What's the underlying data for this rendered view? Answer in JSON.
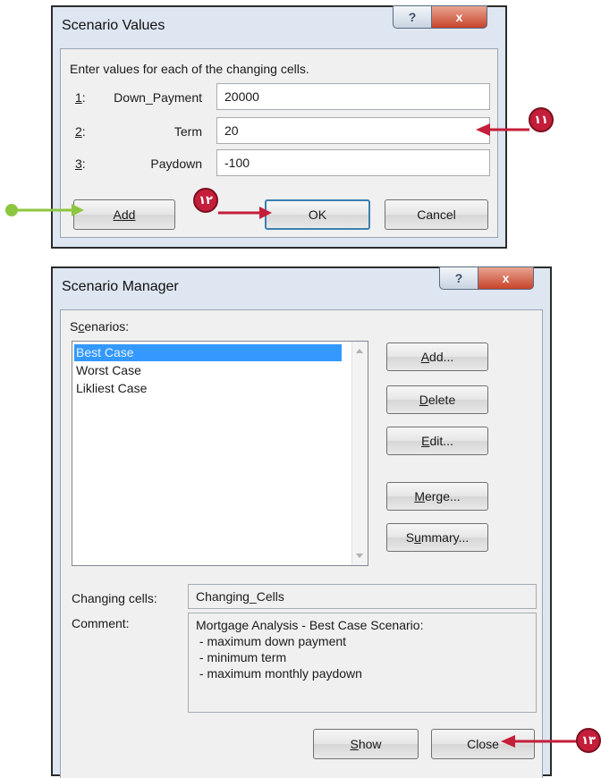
{
  "scenario_values": {
    "title": "Scenario Values",
    "help_glyph": "?",
    "close_glyph": "x",
    "instruction": "Enter values for each of the changing cells.",
    "rows": [
      {
        "index": "1",
        "index_suffix": ":",
        "label": "Down_Payment",
        "value": "20000"
      },
      {
        "index": "2",
        "index_suffix": ":",
        "label": "Term",
        "value": "20"
      },
      {
        "index": "3",
        "index_suffix": ":",
        "label": "Paydown",
        "value": "-100"
      }
    ],
    "buttons": {
      "add": "Add",
      "ok": "OK",
      "cancel": "Cancel"
    }
  },
  "scenario_manager": {
    "title": "Scenario Manager",
    "help_glyph": "?",
    "close_glyph": "x",
    "scenarios_label_pre": "S",
    "scenarios_label_u": "c",
    "scenarios_label_post": "enarios:",
    "scenarios": [
      "Best Case",
      "Worst Case",
      "Likliest Case"
    ],
    "selected_index": 0,
    "buttons": {
      "add": {
        "u": "A",
        "rest": "dd..."
      },
      "delete": {
        "u": "D",
        "rest": "elete"
      },
      "edit": {
        "u": "E",
        "rest": "dit..."
      },
      "merge": {
        "u": "M",
        "rest": "erge..."
      },
      "summary_pre": "S",
      "summary_u": "u",
      "summary_rest": "mmary...",
      "show": {
        "u": "S",
        "rest": "how"
      },
      "close": "Close"
    },
    "changing_cells_label": "Changing cells:",
    "changing_cells_value": "Changing_Cells",
    "comment_label": "Comment:",
    "comment_lines": [
      "Mortgage Analysis - Best Case Scenario:",
      " - maximum down payment",
      " - minimum term",
      " - maximum monthly paydown"
    ]
  },
  "callouts": {
    "step_11": "١١",
    "step_12": "١٢",
    "step_13": "١٣",
    "red_color": "#c41e3a",
    "green_color": "#8cc63f"
  }
}
